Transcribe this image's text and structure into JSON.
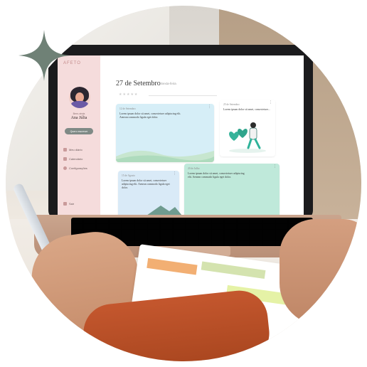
{
  "app": {
    "logo": "AFETO",
    "greeting": "Bem-vinda",
    "user_name": "Ana Júlia",
    "cta_button": "Quero escrever",
    "nav": [
      {
        "label": "Meu diário",
        "icon": "book-icon"
      },
      {
        "label": "Calendário",
        "icon": "calendar-icon"
      },
      {
        "label": "Configurações",
        "icon": "gear-icon"
      }
    ],
    "logout": "Sair"
  },
  "header": {
    "date": "27 de Setembro",
    "weekday": "Sexta-feira",
    "rating_stars": "★★★★★"
  },
  "cards": [
    {
      "date": "12 de Setembro",
      "text": "Lorem ipsum dolor sit amet, consectetuer adipiscing elit. Aenean commodo ligula eget dolor.",
      "color": "#d6eef7"
    },
    {
      "date": "25 de Setembro",
      "text": "Lorem ipsum dolor sit amet, consectetuer...",
      "color": "#ffffff"
    },
    {
      "date": "15 de Agosto",
      "text": "Lorem ipsum dolor sit amet, consectetuer adipiscing elit. Aenean commodo ligula eget dolor.",
      "color": "#d9eaf7"
    },
    {
      "date": "20 de Julho",
      "text": "Lorem ipsum dolor sit amet, consectetuer adipiscing elit. Aenean commodo ligula eget dolor.",
      "color": "#bfe9da"
    }
  ],
  "colors": {
    "sidebar": "#f5dcdc",
    "accent_star": "#6f8176",
    "button": "#7f8a86"
  }
}
